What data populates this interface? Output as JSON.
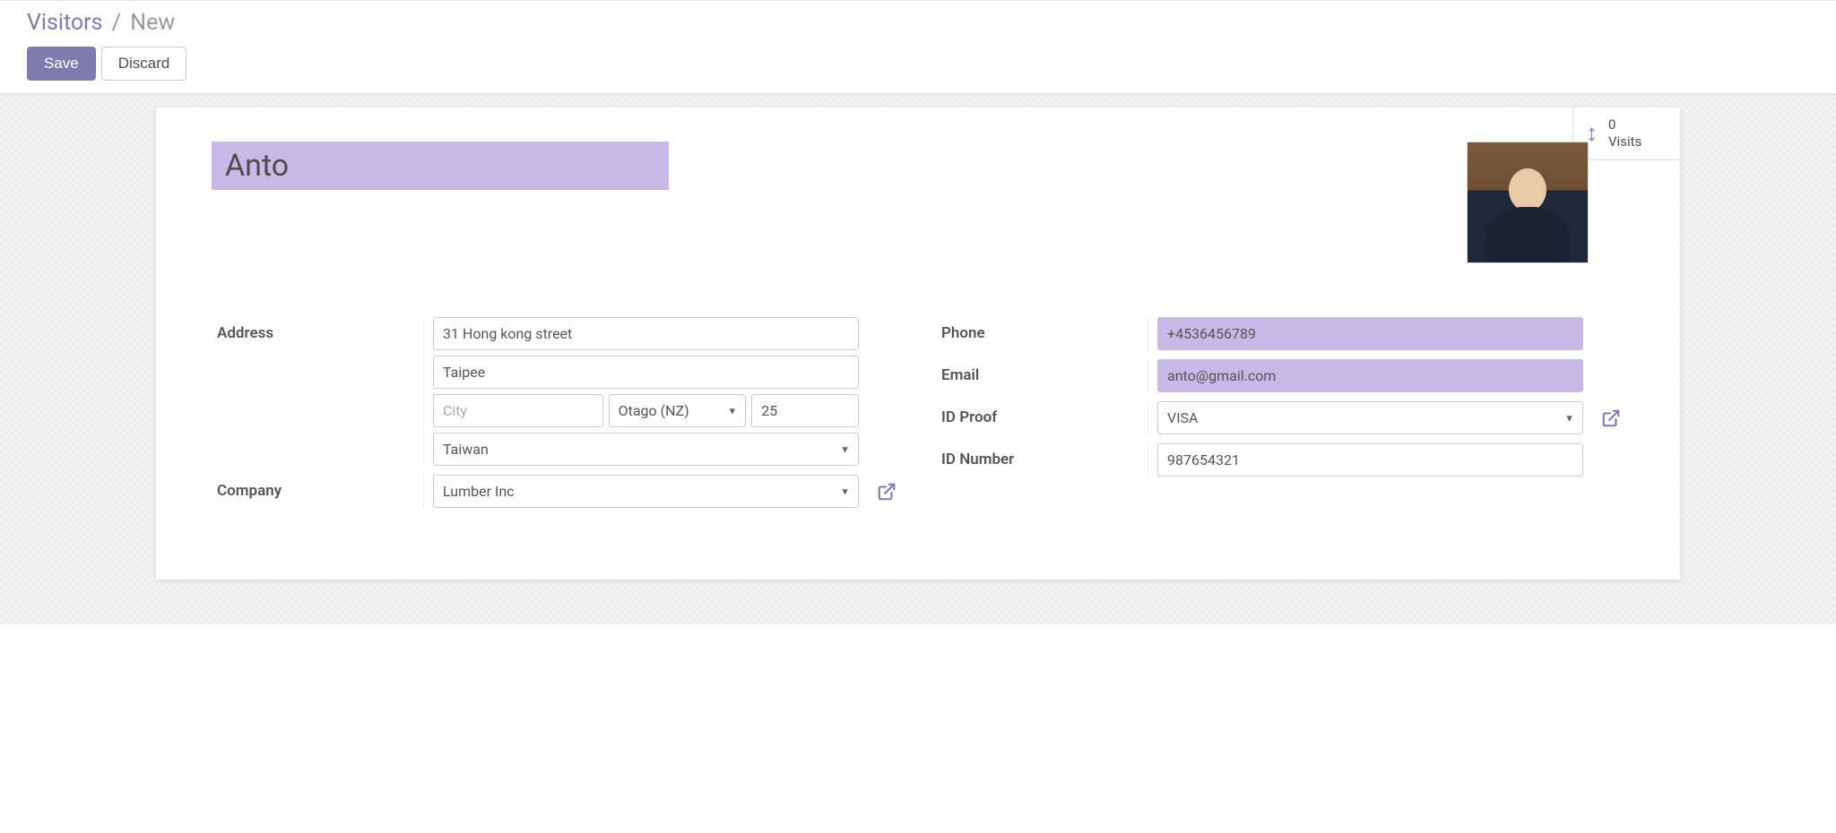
{
  "breadcrumb": {
    "root": "Visitors",
    "sep": "/",
    "current": "New"
  },
  "buttons": {
    "save": "Save",
    "discard": "Discard"
  },
  "stat": {
    "count": "0",
    "label": "Visits"
  },
  "form": {
    "name": "Anto",
    "labels": {
      "address": "Address",
      "company": "Company",
      "phone": "Phone",
      "email": "Email",
      "id_proof": "ID Proof",
      "id_number": "ID Number"
    },
    "address": {
      "street1": "31 Hong kong street",
      "street2": "Taipee",
      "city": "",
      "city_placeholder": "City",
      "state": "Otago (NZ)",
      "zip": "25",
      "country": "Taiwan"
    },
    "company": "Lumber Inc",
    "phone": "+4536456789",
    "email": "anto@gmail.com",
    "id_proof": "VISA",
    "id_number": "987654321"
  }
}
